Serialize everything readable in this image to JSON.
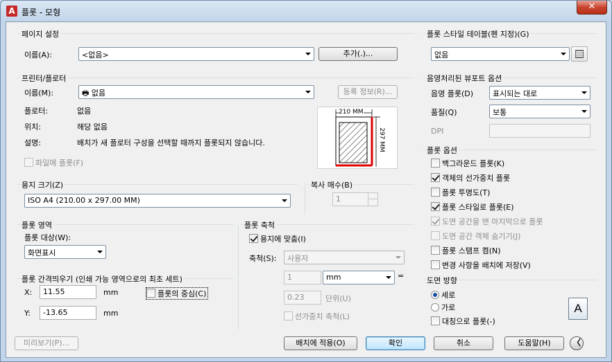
{
  "window": {
    "title": "플롯 - 모형",
    "close_glyph": "✕"
  },
  "page_setup": {
    "group": "페이지 설정",
    "name_label": "이름(A):",
    "name_value": "<없음>",
    "add_button": "추가(.)..."
  },
  "plotter": {
    "group": "프린터/플로터",
    "name_label": "이름(M):",
    "name_value": "없음",
    "properties_button": "등록 정보(R)...",
    "plotter_label": "플로터:",
    "plotter_value": "없음",
    "location_label": "위치:",
    "location_value": "해당 없음",
    "description_label": "설명:",
    "description_value": "배치가 새 플로터 구성을 선택할 때까지 플롯되지 않습니다.",
    "plot_to_file": "파일에 플롯(F)",
    "preview_width": "210 MM",
    "preview_height": "297 MM"
  },
  "paper_size": {
    "group": "용지 크기(Z)",
    "value": "ISO A4 (210.00 x 297.00 MM)"
  },
  "copies": {
    "group": "복사 매수(B)",
    "value": "1"
  },
  "plot_area": {
    "group": "플롯 영역",
    "what_label": "플롯 대상(W):",
    "what_value": "화면표시"
  },
  "plot_scale": {
    "group": "플롯 축척",
    "fit_to_paper": "용지에 맞춤(I)",
    "scale_label": "축척(S):",
    "scale_value": "사용자",
    "value1": "1",
    "unit_value": "mm",
    "equals": "=",
    "value2": "0.23",
    "units_label": "단위(U)",
    "scale_lineweights": "선가중치 축척(L)"
  },
  "plot_offset": {
    "group": "플롯 간격띄우기 (인쇄 가능 영역으로의 최초 세트)",
    "x_label": "X:",
    "x_value": "11.55",
    "x_unit": "mm",
    "y_label": "Y:",
    "y_value": "-13.65",
    "y_unit": "mm",
    "center": "플롯의 중심(C)"
  },
  "plot_style_table": {
    "group": "플롯 스타일 테이블(펜 지정)(G)",
    "value": "없음"
  },
  "shaded_viewport": {
    "group": "음영처리된 뷰포트 옵션",
    "shade_label": "음영 플롯(D)",
    "shade_value": "표시되는 대로",
    "quality_label": "품질(Q)",
    "quality_value": "보통",
    "dpi_label": "DPI",
    "dpi_value": ""
  },
  "plot_options": {
    "group": "플롯 옵션",
    "items": [
      {
        "label": "백그라운드 플롯(K)",
        "checked": false,
        "enabled": true
      },
      {
        "label": "객체의 선가중치 플롯",
        "checked": true,
        "enabled": true
      },
      {
        "label": "플롯 투명도(T)",
        "checked": false,
        "enabled": true
      },
      {
        "label": "플롯 스타일로 플롯(E)",
        "checked": true,
        "enabled": true
      },
      {
        "label": "도면 공간을 맨 마지막으로 플롯",
        "checked": true,
        "enabled": false
      },
      {
        "label": "도면 공간 객체 숨기기(J)",
        "checked": false,
        "enabled": false
      },
      {
        "label": "플롯 스탬프 켬(N)",
        "checked": false,
        "enabled": true
      },
      {
        "label": "변경 사항을 배치에 저장(V)",
        "checked": false,
        "enabled": true
      }
    ]
  },
  "orientation": {
    "group": "도면 방향",
    "portrait": "세로",
    "landscape": "가로",
    "upside_down": "대칭으로 플롯(-)",
    "orientation_icon": "A"
  },
  "footer": {
    "preview": "미리보기(P)...",
    "apply_to_layout": "배치에 적용(O)",
    "ok": "확인",
    "cancel": "취소",
    "help": "도움말(H)",
    "more_options_glyph": "〈"
  }
}
